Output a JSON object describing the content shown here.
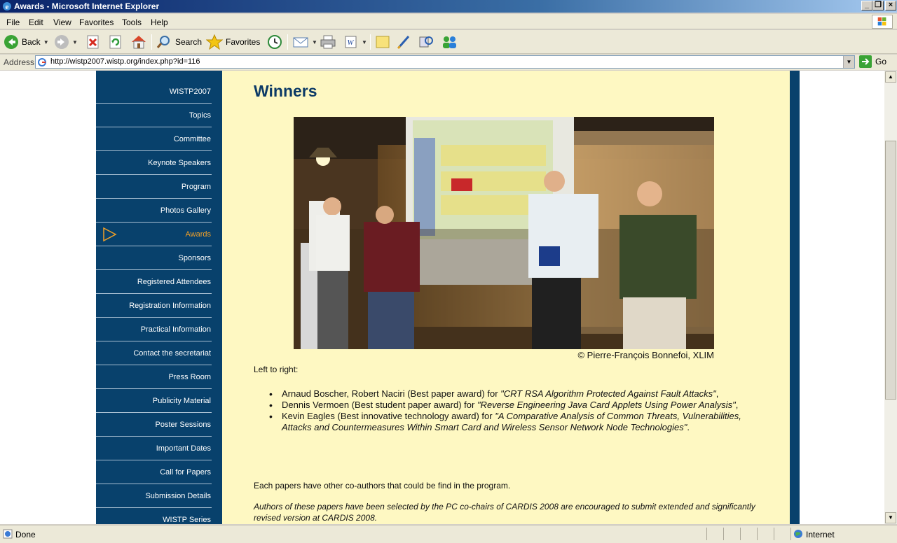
{
  "window": {
    "title": "Awards - Microsoft Internet Explorer"
  },
  "menu": [
    "File",
    "Edit",
    "View",
    "Favorites",
    "Tools",
    "Help"
  ],
  "toolbar": {
    "back_label": "Back",
    "search_label": "Search",
    "favorites_label": "Favorites"
  },
  "address": {
    "label": "Address",
    "url": "http://wistp2007.wistp.org/index.php?id=116",
    "go_label": "Go"
  },
  "sidebar": {
    "items": [
      {
        "label": "WISTP2007"
      },
      {
        "label": "Topics"
      },
      {
        "label": "Committee"
      },
      {
        "label": "Keynote Speakers"
      },
      {
        "label": "Program"
      },
      {
        "label": "Photos Gallery"
      },
      {
        "label": "Awards",
        "active": true
      },
      {
        "label": "Sponsors"
      },
      {
        "label": "Registered Attendees"
      },
      {
        "label": "Registration Information"
      },
      {
        "label": "Practical Information"
      },
      {
        "label": "Contact the secretariat"
      },
      {
        "label": "Press Room"
      },
      {
        "label": "Publicity Material"
      },
      {
        "label": "Poster Sessions"
      },
      {
        "label": "Important Dates"
      },
      {
        "label": "Call for Papers"
      },
      {
        "label": "Submission Details"
      },
      {
        "label": "WISTP Series"
      }
    ]
  },
  "main": {
    "heading": "Winners",
    "photo_credit": "© Pierre-François Bonnefoi, XLIM",
    "left_to_right": "Left to right:",
    "awards": [
      {
        "people": "Arnaud Boscher, Robert Naciri (Best paper award) for ",
        "title": "\"CRT RSA Algorithm Protected Against Fault Attacks\"",
        "end": ","
      },
      {
        "people": "Dennis Vermoen (Best student paper award) for ",
        "title": "\"Reverse Engineering Java Card Applets Using Power Analysis\"",
        "end": ","
      },
      {
        "people": "Kevin Eagles (Best innovative technology award) for ",
        "title": "\"A Comparative Analysis of Common Threats, Vulnerabilities, Attacks and Countermeasures Within Smart Card and Wireless Sensor Network Node Technologies\"",
        "end": "."
      }
    ],
    "coauthors_note": "Each papers have other co-authors that could be find in the program.",
    "cardis_note": "Authors of these papers have been selected by the PC co-chairs of CARDIS 2008 are encouraged to submit extended and significantly revised version at CARDIS 2008."
  },
  "status": {
    "text": "Done",
    "zone": "Internet"
  },
  "colors": {
    "sidebar_bg": "#08416c",
    "content_bg": "#fef8c2",
    "heading": "#0c3a66",
    "active_nav": "#f0a028"
  }
}
